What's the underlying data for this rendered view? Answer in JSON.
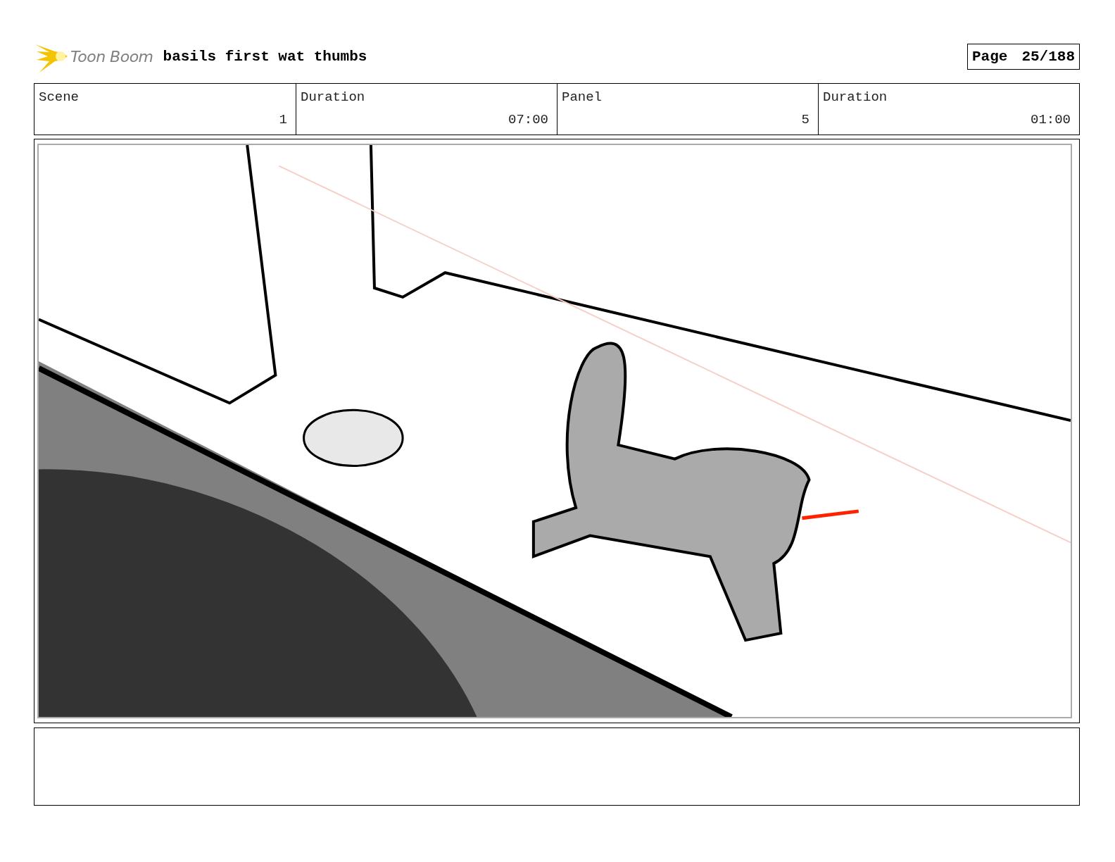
{
  "header": {
    "logo": "Toon Boom",
    "title": "basils first wat thumbs",
    "page_label": "Page",
    "page_number": "25/188"
  },
  "info": [
    {
      "label": "Scene",
      "value": "1"
    },
    {
      "label": "Duration",
      "value": "07:00"
    },
    {
      "label": "Panel",
      "value": "5"
    },
    {
      "label": "Duration",
      "value": "01:00"
    }
  ]
}
